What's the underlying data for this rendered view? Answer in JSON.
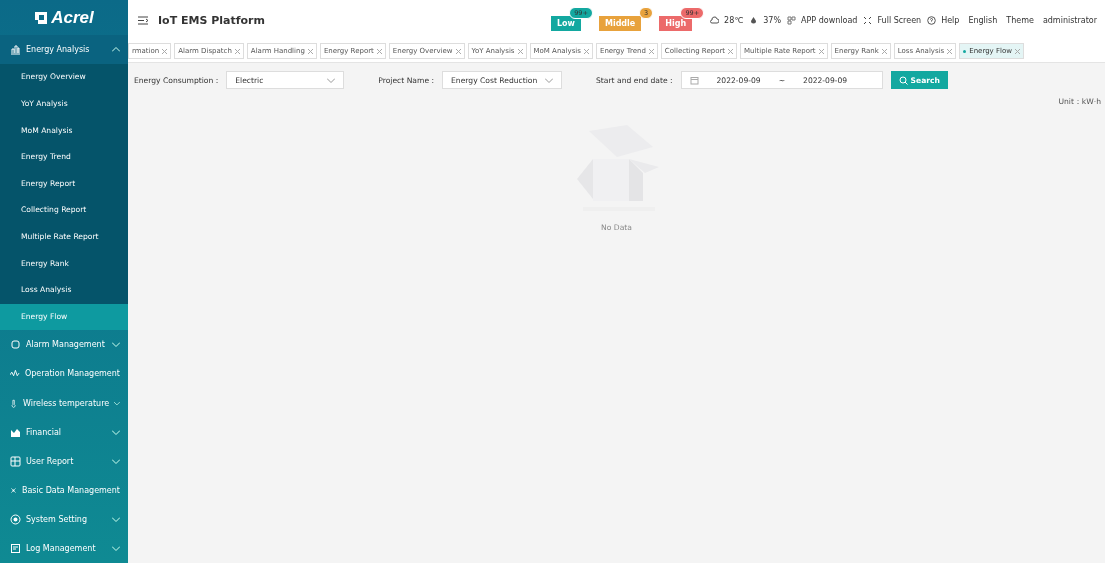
{
  "logo": "Acrel",
  "app_title": "IoT EMS Platform",
  "alarm_badges": [
    {
      "label": "Low",
      "count": "99+",
      "color": "#13a8a0"
    },
    {
      "label": "Middle",
      "count": "3",
      "color": "#e8a23c"
    },
    {
      "label": "High",
      "count": "99+",
      "color": "#ec6a6a"
    }
  ],
  "header_items": [
    {
      "kind": "weather",
      "label": "28℃"
    },
    {
      "kind": "humidity",
      "label": "37%"
    },
    {
      "kind": "qr",
      "label": "APP download"
    },
    {
      "kind": "fullscreen",
      "label": "Full Screen"
    },
    {
      "kind": "help",
      "label": "Help"
    },
    {
      "kind": "text",
      "label": "English"
    },
    {
      "kind": "text",
      "label": "Theme"
    },
    {
      "kind": "text",
      "label": "administrator"
    }
  ],
  "sidebar": {
    "items": [
      {
        "label": "Energy Analysis",
        "expanded": true,
        "has_caret": true,
        "children": [
          {
            "label": "Energy Overview",
            "selected": false
          },
          {
            "label": "YoY Analysis",
            "selected": false
          },
          {
            "label": "MoM Analysis",
            "selected": false
          },
          {
            "label": "Energy Trend",
            "selected": false
          },
          {
            "label": "Energy Report",
            "selected": false
          },
          {
            "label": "Collecting Report",
            "selected": false
          },
          {
            "label": "Multiple Rate Report",
            "selected": false
          },
          {
            "label": "Energy Rank",
            "selected": false
          },
          {
            "label": "Loss Analysis",
            "selected": false
          },
          {
            "label": "Energy Flow",
            "selected": true
          }
        ]
      },
      {
        "label": "Alarm Management",
        "expanded": false,
        "has_caret": true
      },
      {
        "label": "Operation Management",
        "expanded": false,
        "has_caret": false
      },
      {
        "label": "Wireless temperature",
        "expanded": false,
        "has_caret": true
      },
      {
        "label": "Financial",
        "expanded": false,
        "has_caret": true
      },
      {
        "label": "User Report",
        "expanded": false,
        "has_caret": true
      },
      {
        "label": "Basic Data Management",
        "expanded": false,
        "has_caret": false
      },
      {
        "label": "System Setting",
        "expanded": false,
        "has_caret": true
      },
      {
        "label": "Log Management",
        "expanded": false,
        "has_caret": true
      }
    ]
  },
  "tabs": [
    {
      "label": "rmation",
      "selected": false
    },
    {
      "label": "Alarm Dispatch",
      "selected": false
    },
    {
      "label": "Alarm Handling",
      "selected": false
    },
    {
      "label": "Energy Report",
      "selected": false
    },
    {
      "label": "Energy Overview",
      "selected": false
    },
    {
      "label": "YoY Analysis",
      "selected": false
    },
    {
      "label": "MoM Analysis",
      "selected": false
    },
    {
      "label": "Energy Trend",
      "selected": false
    },
    {
      "label": "Collecting Report",
      "selected": false
    },
    {
      "label": "Multiple Rate Report",
      "selected": false
    },
    {
      "label": "Energy Rank",
      "selected": false
    },
    {
      "label": "Loss Analysis",
      "selected": false
    },
    {
      "label": "Energy Flow",
      "selected": true
    }
  ],
  "filters": {
    "energy_label": "Energy Consumption :",
    "energy_value": "Electric",
    "project_label": "Project Name :",
    "project_value": "Energy Cost Reduction",
    "date_label": "Start and end date :",
    "start_date": "2022-09-09",
    "separator": "~",
    "end_date": "2022-09-09",
    "search_button": "Search"
  },
  "unit": "Unit：kW·h",
  "empty_text": "No Data"
}
